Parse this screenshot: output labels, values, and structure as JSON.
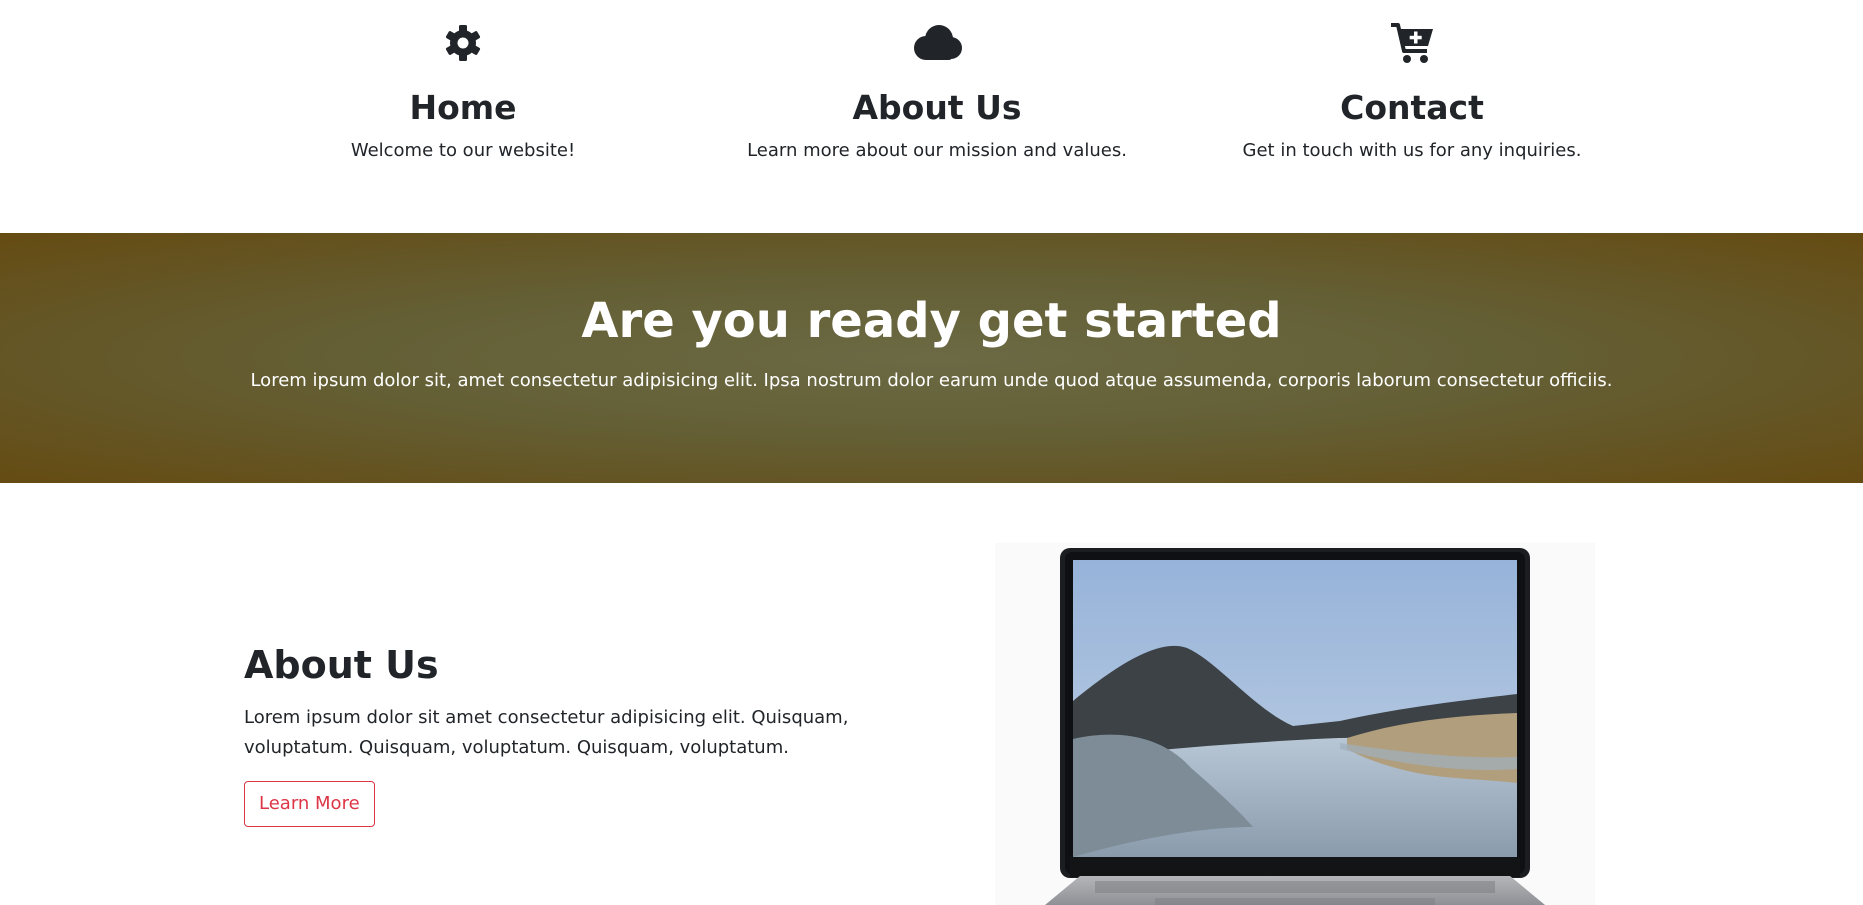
{
  "features": [
    {
      "icon": "gear-icon",
      "title": "Home",
      "text": "Welcome to our website!"
    },
    {
      "icon": "cloud-icon",
      "title": "About Us",
      "text": "Learn more about our mission and values."
    },
    {
      "icon": "cart-plus-icon",
      "title": "Contact",
      "text": "Get in touch with us for any inquiries."
    }
  ],
  "cta": {
    "title": "Are you ready get started",
    "text": "Lorem ipsum dolor sit, amet consectetur adipisicing elit. Ipsa nostrum dolor earum unde quod atque assumenda, corporis laborum consectetur officiis."
  },
  "about": {
    "title": "About Us",
    "text": "Lorem ipsum dolor sit amet consectetur adipisicing elit. Quisquam, voluptatum. Quisquam, voluptatum. Quisquam, voluptatum.",
    "button_label": "Learn More",
    "image": "laptop-landscape-image"
  },
  "colors": {
    "text": "#212529",
    "cta_center": "#6b6a44",
    "cta_edge": "#654b12",
    "button_accent": "#dc3545"
  }
}
